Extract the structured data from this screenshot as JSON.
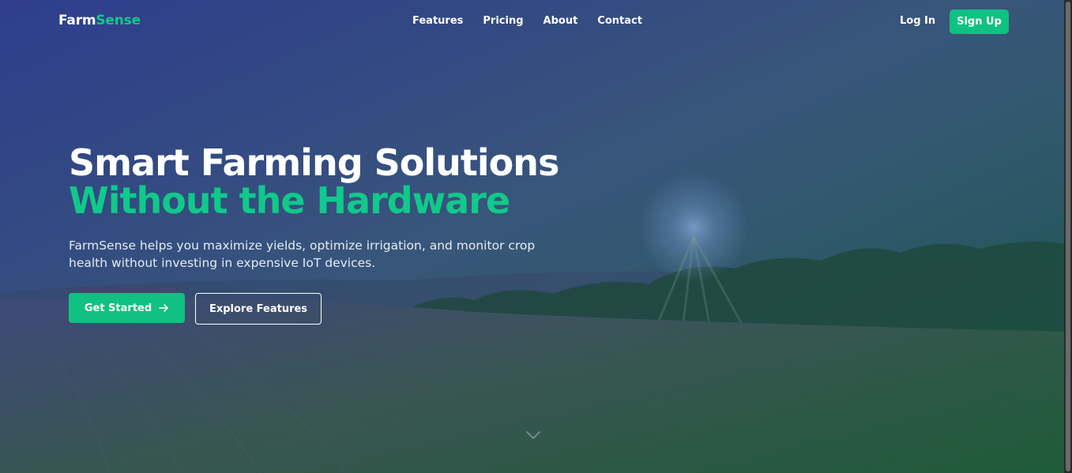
{
  "brand": {
    "name_part1": "Farm",
    "name_part2": "Sense",
    "accent_color": "#10c98a"
  },
  "nav": {
    "links": [
      {
        "label": "Features"
      },
      {
        "label": "Pricing"
      },
      {
        "label": "About"
      },
      {
        "label": "Contact"
      }
    ],
    "login_label": "Log In",
    "signup_label": "Sign Up"
  },
  "hero": {
    "headline_line1": "Smart Farming Solutions",
    "headline_line2": "Without the Hardware",
    "subtext": "FarmSense helps you maximize yields, optimize irrigation, and monitor crop health without investing in expensive IoT devices.",
    "primary_cta": "Get Started",
    "primary_cta_icon": "arrow-right-icon",
    "secondary_cta": "Explore Features",
    "scroll_icon": "chevron-down-icon"
  },
  "colors": {
    "primary_button": "#10c182",
    "overlay_top_left": "#2d3a8c",
    "overlay_bottom_right": "#0f5a3a"
  }
}
